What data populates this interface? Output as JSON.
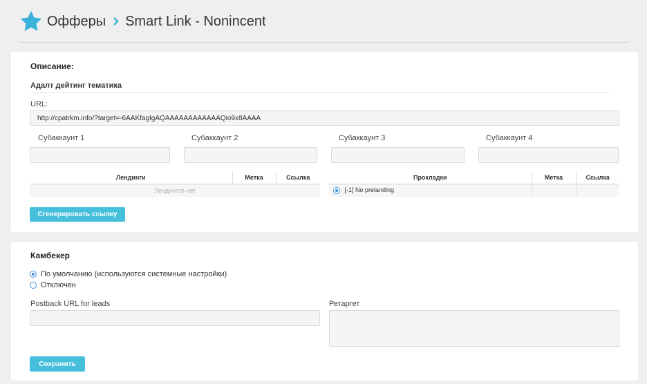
{
  "header": {
    "section": "Офферы",
    "title": "Smart Link - Nonincent"
  },
  "offer": {
    "description_heading": "Описание:",
    "topic": "Адалт дейтинг тематика",
    "url_label": "URL:",
    "url_value": "http://cpatrkm.info/?target=-6AAKfagIgAQAAAAAAAAAAAAQio9x8AAAA",
    "subaccounts": [
      {
        "label": "Субаккаунт 1",
        "value": ""
      },
      {
        "label": "Субаккаунт 2",
        "value": ""
      },
      {
        "label": "Субаккаунт 3",
        "value": ""
      },
      {
        "label": "Субаккаунт 4",
        "value": ""
      }
    ],
    "landings_table": {
      "columns": [
        "Лендинги",
        "Метка",
        "Ссылка"
      ],
      "empty_text": "Лендингов нет"
    },
    "preland_table": {
      "columns": [
        "Прокладки",
        "Метка",
        "Ссылка"
      ],
      "rows": [
        {
          "label": "[-1] No prelanding",
          "selected": true,
          "tag": "",
          "link": ""
        }
      ]
    },
    "generate_button": "Сгенерировать ссылку"
  },
  "cambecker": {
    "heading": "Камбекер",
    "options": [
      {
        "label": "По умолчанию (используются системные настройки)",
        "selected": true
      },
      {
        "label": "Отключен",
        "selected": false
      }
    ],
    "postback_label": "Postback URL for leads",
    "postback_value": "",
    "retarget_label": "Ретаргет",
    "retarget_value": "",
    "save_button": "Сохранить"
  },
  "colors": {
    "accent": "#45bfdc",
    "star": "#3ab3db",
    "radio": "#3d8ed6"
  },
  "icons": {
    "header_icon": "star-icon",
    "breadcrumb_separator": "chevron-right-icon"
  }
}
